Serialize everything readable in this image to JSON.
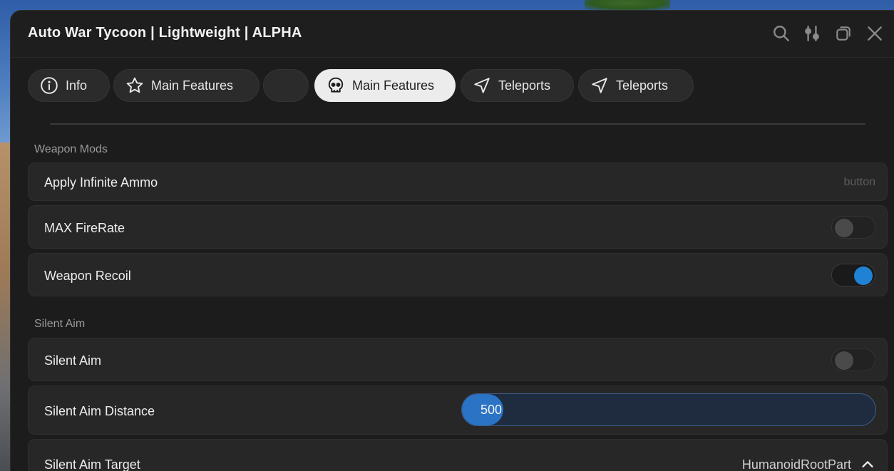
{
  "window": {
    "title": "Auto War Tycoon | Lightweight | ALPHA"
  },
  "toolbar": {
    "icons": [
      "search-icon",
      "sliders-icon",
      "minimize-icon",
      "close-icon"
    ]
  },
  "tabs": [
    {
      "label": "Info",
      "icon": "info-icon",
      "active": false
    },
    {
      "label": "Main Features",
      "icon": "star-icon",
      "active": false
    },
    {
      "label": "",
      "icon": "",
      "active": false
    },
    {
      "label": "Main Features",
      "icon": "skull-icon",
      "active": true
    },
    {
      "label": "Teleports",
      "icon": "send-icon",
      "active": false
    },
    {
      "label": "Teleports",
      "icon": "send-icon",
      "active": false
    }
  ],
  "sections": {
    "weapon_mods": {
      "label": "Weapon Mods",
      "items": {
        "infinite_ammo": {
          "label": "Apply Infinite Ammo",
          "hint": "button"
        },
        "max_firerate": {
          "label": "MAX FireRate",
          "enabled": false
        },
        "weapon_recoil": {
          "label": "Weapon Recoil",
          "enabled": true
        }
      }
    },
    "silent_aim": {
      "label": "Silent Aim",
      "items": {
        "silent_aim": {
          "label": "Silent Aim",
          "enabled": false
        },
        "distance": {
          "label": "Silent Aim Distance",
          "value": "500",
          "fill_fraction": 0.1
        },
        "target": {
          "label": "Silent Aim Target",
          "value": "HumanoidRootPart"
        }
      }
    }
  },
  "colors": {
    "accent": "#1f82d4",
    "slider_fill": "#2b73c4",
    "background": "#1c1c1c",
    "row": "#272727"
  }
}
